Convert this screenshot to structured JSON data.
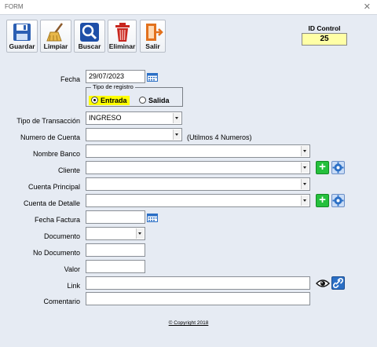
{
  "window": {
    "title": "FORM",
    "close_glyph": "✕"
  },
  "toolbar": {
    "guardar": "Guardar",
    "limpiar": "Limpiar",
    "buscar": "Buscar",
    "eliminar": "Eliminar",
    "salir": "Salir"
  },
  "id_control": {
    "label": "ID Control",
    "value": "25"
  },
  "form": {
    "fecha_label": "Fecha",
    "fecha_value": "29/07/2023",
    "tipo_registro_title": "Tipo de registro",
    "opt_entrada": "Entrada",
    "opt_salida": "Salida",
    "tipo_transaccion_label": "Tipo de Transacción",
    "tipo_transaccion_value": "INGRESO",
    "numero_cuenta_label": "Numero de Cuenta",
    "numero_cuenta_hint": "(Utilmos 4 Numeros)",
    "nombre_banco_label": "Nombre Banco",
    "cliente_label": "Cliente",
    "cuenta_principal_label": "Cuenta Principal",
    "cuenta_detalle_label": "Cuenta de Detalle",
    "fecha_factura_label": "Fecha Factura",
    "documento_label": "Documento",
    "no_documento_label": "No Documento",
    "valor_label": "Valor",
    "link_label": "Link",
    "comentario_label": "Comentario",
    "plus_glyph": "+"
  },
  "footer": {
    "copyright": "© Copyright 2018"
  },
  "colors": {
    "id_bg": "#ffffa6",
    "selected_option_bg": "#ffff00",
    "plus_green": "#25c03d",
    "save_blue": "#2b5fb3",
    "delete_red": "#c8261e",
    "exit_orange": "#e2711d"
  }
}
